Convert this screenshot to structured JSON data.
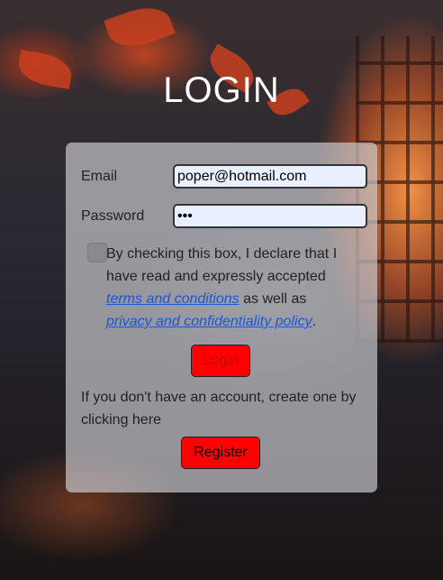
{
  "page": {
    "title": "LOGIN"
  },
  "form": {
    "email_label": "Email",
    "email_value": "poper@hotmail.com",
    "password_label": "Password",
    "password_value": "•••",
    "consent": {
      "text_before": "By checking this box, I declare that I have read and expressly accepted",
      "terms_link": "terms and conditions",
      "text_middle": "as well as",
      "privacy_link": "privacy and confidentiality policy",
      "text_after": "."
    },
    "checkbox_checked": false,
    "login_label": "Login",
    "register_hint": "If you don't have an account, create one by clicking here",
    "register_label": "Register"
  },
  "colors": {
    "button_red": "#ff0000",
    "link_blue": "#1a56d6",
    "input_bg": "#e8efff"
  }
}
